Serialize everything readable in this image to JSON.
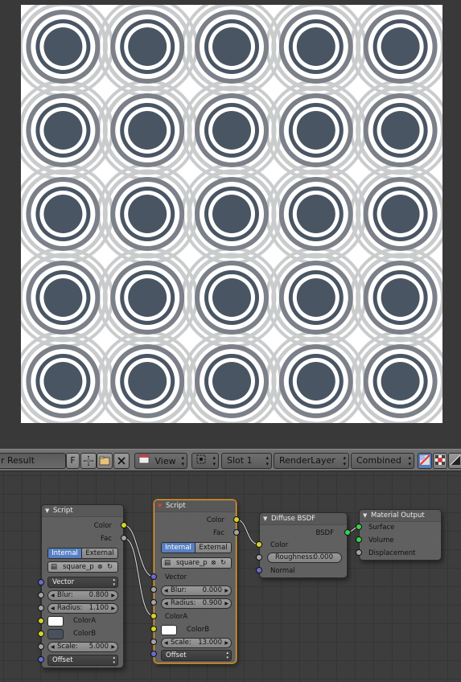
{
  "render": {
    "colors": {
      "background": "#ffffff",
      "light_ring": "#c9cbcd",
      "dark": "#4a5563",
      "mid": "#7c8088"
    }
  },
  "header": {
    "result_field": "r Result",
    "fake_user_label": "F",
    "view_menu": "View",
    "slot": "Slot 1",
    "layer": "RenderLayer",
    "pass": "Combined",
    "icons": [
      "plus-icon",
      "open-folder-icon",
      "close-icon",
      "image-icon",
      "zoom-region-icon",
      "draw-rgb-icon",
      "draw-alpha-icon",
      "draw-mask-icon"
    ]
  },
  "nodes": {
    "script1": {
      "title": "Script",
      "out_color": "Color",
      "out_fac": "Fac",
      "mode_internal": "Internal",
      "mode_external": "External",
      "file": "square_p",
      "vector": "Vector",
      "blur_label": "Blur:",
      "blur_value": "0.800",
      "radius_label": "Radius:",
      "radius_value": "1.100",
      "colora": "ColorA",
      "colorb": "ColorB",
      "colora_swatch": "#ffffff",
      "colorb_swatch": "#48525e",
      "scale_label": "Scale:",
      "scale_value": "5.000",
      "offset": "Offset"
    },
    "script2": {
      "title": "Script",
      "out_color": "Color",
      "out_fac": "Fac",
      "mode_internal": "Internal",
      "mode_external": "External",
      "file": "square_p",
      "vector": "Vector",
      "blur_label": "Blur:",
      "blur_value": "0.000",
      "radius_label": "Radius:",
      "radius_value": "0.900",
      "colora": "ColorA",
      "colorb": "ColorB",
      "colorb_swatch": "#ffffff",
      "scale_label": "Scale:",
      "scale_value": "13.000",
      "offset": "Offset"
    },
    "diffuse": {
      "title": "Diffuse BSDF",
      "out_bsdf": "BSDF",
      "in_color": "Color",
      "roughness_label": "Roughness:",
      "roughness_value": "0.000",
      "in_normal": "Normal"
    },
    "output": {
      "title": "Material Output",
      "surface": "Surface",
      "volume": "Volume",
      "displacement": "Displacement"
    }
  }
}
